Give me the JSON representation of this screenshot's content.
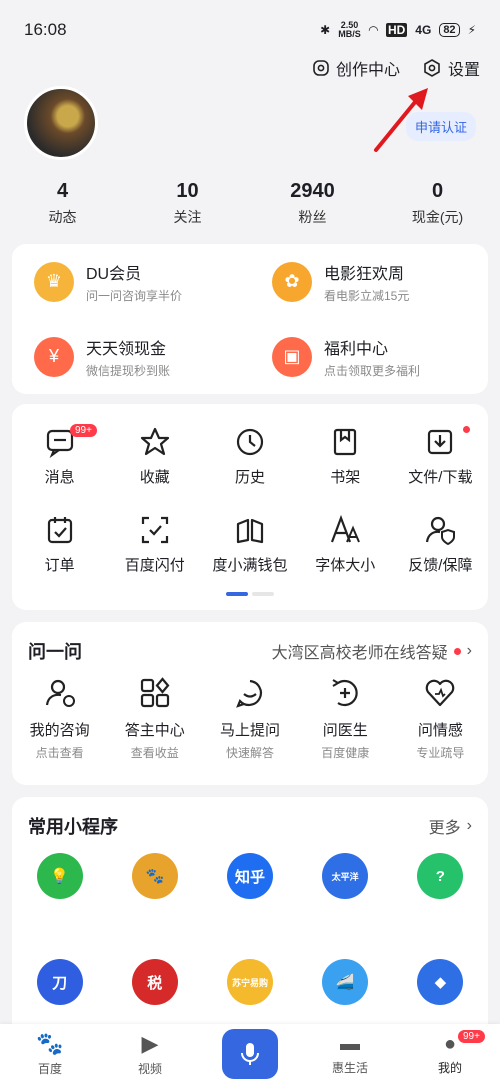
{
  "status": {
    "time": "16:08",
    "net": "2.50",
    "net_unit": "MB/S",
    "hd": "HD",
    "signal": "4G",
    "battery": "82"
  },
  "topbar": {
    "creator": "创作中心",
    "settings": "设置"
  },
  "profile": {
    "apply_label": "申请认证"
  },
  "stats": [
    {
      "value": "4",
      "label": "动态"
    },
    {
      "value": "10",
      "label": "关注"
    },
    {
      "value": "2940",
      "label": "粉丝"
    },
    {
      "value": "0",
      "label": "现金(元)"
    }
  ],
  "promos": [
    {
      "title": "DU会员",
      "sub": "问一问咨询享半价",
      "icon": "crown-icon",
      "color": "#f6b53a"
    },
    {
      "title": "电影狂欢周",
      "sub": "看电影立减15元",
      "icon": "film-reel-icon",
      "color": "#f7a62e"
    },
    {
      "title": "天天领现金",
      "sub": "微信提现秒到账",
      "icon": "red-envelope-icon",
      "color": "#ff6b4a"
    },
    {
      "title": "福利中心",
      "sub": "点击领取更多福利",
      "icon": "gift-icon",
      "color": "#ff6b4a"
    }
  ],
  "tools": [
    {
      "label": "消息",
      "icon": "message-icon",
      "badge": "99+"
    },
    {
      "label": "收藏",
      "icon": "star-icon"
    },
    {
      "label": "历史",
      "icon": "clock-icon"
    },
    {
      "label": "书架",
      "icon": "bookmark-icon"
    },
    {
      "label": "文件/下载",
      "icon": "download-icon",
      "dot": true
    },
    {
      "label": "订单",
      "icon": "order-icon"
    },
    {
      "label": "百度闪付",
      "icon": "scan-pay-icon"
    },
    {
      "label": "度小满钱包",
      "icon": "wallet-icon"
    },
    {
      "label": "字体大小",
      "icon": "font-size-icon"
    },
    {
      "label": "反馈/保障",
      "icon": "feedback-icon"
    }
  ],
  "ask": {
    "title": "问一问",
    "more": "大湾区高校老师在线答疑",
    "items": [
      {
        "title": "我的咨询",
        "sub": "点击查看",
        "icon": "consult-icon"
      },
      {
        "title": "答主中心",
        "sub": "查看收益",
        "icon": "apps-icon"
      },
      {
        "title": "马上提问",
        "sub": "快速解答",
        "icon": "chat-icon"
      },
      {
        "title": "问医生",
        "sub": "百度健康",
        "icon": "doctor-icon"
      },
      {
        "title": "问情感",
        "sub": "专业疏导",
        "icon": "heart-icon"
      }
    ]
  },
  "mini": {
    "title": "常用小程序",
    "more": "更多",
    "apps": [
      {
        "glyph": "💡",
        "color": "#2db84d",
        "icon": "bulb-app-icon"
      },
      {
        "glyph": "🐾",
        "color": "#e8a32d",
        "icon": "paw-app-icon"
      },
      {
        "glyph": "知乎",
        "color": "#1f6ef2",
        "icon": "zhihu-app-icon"
      },
      {
        "glyph": "太平洋",
        "color": "#2f6fe6",
        "icon": "pconline-app-icon"
      },
      {
        "glyph": "?",
        "color": "#25c26b",
        "icon": "question-app-icon"
      },
      {
        "glyph": "刀",
        "color": "#2f5fe0",
        "icon": "blue-app-icon"
      },
      {
        "glyph": "税",
        "color": "#d62a2a",
        "icon": "tax-app-icon"
      },
      {
        "glyph": "苏宁易购",
        "color": "#f4b92c",
        "icon": "suning-app-icon"
      },
      {
        "glyph": "🚄",
        "color": "#3aa0f0",
        "icon": "train-app-icon"
      },
      {
        "glyph": "◆",
        "color": "#2f6fe6",
        "icon": "diamond-app-icon"
      }
    ]
  },
  "tabbar": [
    {
      "label": "百度",
      "icon": "baidu-paw-icon"
    },
    {
      "label": "视频",
      "icon": "play-icon"
    },
    {
      "label": "",
      "icon": "microphone-icon"
    },
    {
      "label": "惠生活",
      "icon": "life-icon"
    },
    {
      "label": "我的",
      "icon": "profile-icon",
      "badge": "99+"
    }
  ],
  "colors": {
    "accent": "#3467e0",
    "badge": "#ff3b49",
    "arrow": "#e0191e"
  }
}
